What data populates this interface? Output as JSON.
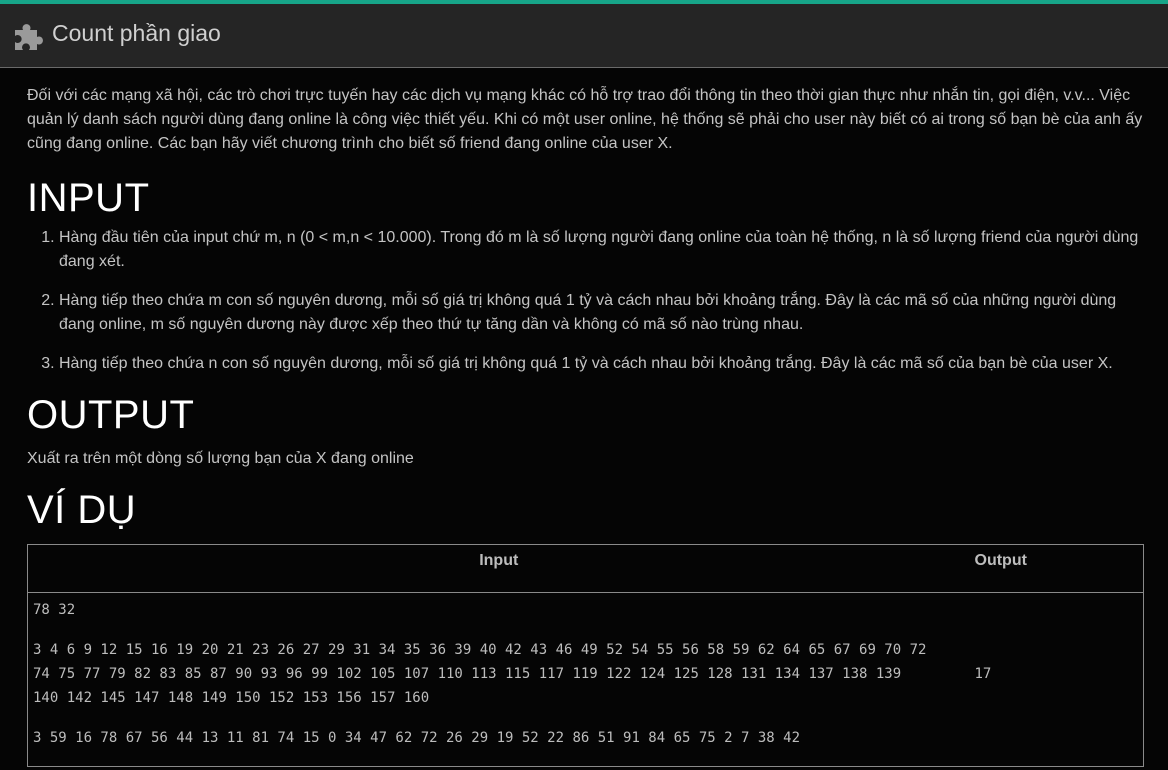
{
  "header": {
    "title": "Count phần giao",
    "icon": "puzzle-piece-icon",
    "accent": "#17a589"
  },
  "description": "Đối với các mạng xã hội, các trò chơi trực tuyến hay các dịch vụ mạng khác có hỗ trợ trao đổi thông tin theo thời gian thực như nhắn tin, gọi điện, v.v... Việc quản lý danh sách người dùng đang online là công việc thiết yếu. Khi có một user online, hệ thống sẽ phải cho user này biết có ai trong số bạn bè của anh ấy cũng đang online. Các bạn hãy viết chương trình cho biết số friend đang online của user X.",
  "input_section": {
    "heading": "INPUT",
    "items": [
      "Hàng đầu tiên của input chứ m, n (0 < m,n < 10.000). Trong đó m là số lượng người đang online của toàn hệ thống, n là số lượng friend của người dùng đang xét.",
      "Hàng tiếp theo chứa m con số nguyên dương, mỗi số giá trị không quá 1 tỷ và cách nhau bởi khoảng trắng. Đây là các mã số của những người dùng đang online, m số nguyên dương này được xếp theo thứ tự tăng dần và không có mã số nào trùng nhau.",
      "Hàng tiếp theo chứa n con số nguyên dương, mỗi số giá trị không quá 1 tỷ và cách nhau bởi khoảng trắng. Đây là các mã số của bạn bè của user X."
    ]
  },
  "output_section": {
    "heading": "OUTPUT",
    "text": "Xuất ra trên một dòng số lượng bạn của X đang online"
  },
  "example_section": {
    "heading": "VÍ DỤ",
    "table": {
      "col_input": "Input",
      "col_output": "Output",
      "input_line1": "78 32",
      "input_line2": "3 4 6 9 12 15 16 19 20 21 23 26 27 29 31 34 35 36 39 40 42 43 46 49 52 54 55 56 58 59 62 64 65 67 69 70 72\n74 75 77 79 82 83 85 87 90 93 96 99 102 105 107 110 113 115 117 119 122 124 125 128 131 134 137 138 139\n140 142 145 147 148 149 150 152 153 156 157 160",
      "input_line3": "3 59 16 78 67 56 44 13 11 81 74 15 0 34 47 62 72 26 29 19 52 22 86 51 91 84 65 75 2 7 38 42",
      "output_value": "17"
    }
  }
}
